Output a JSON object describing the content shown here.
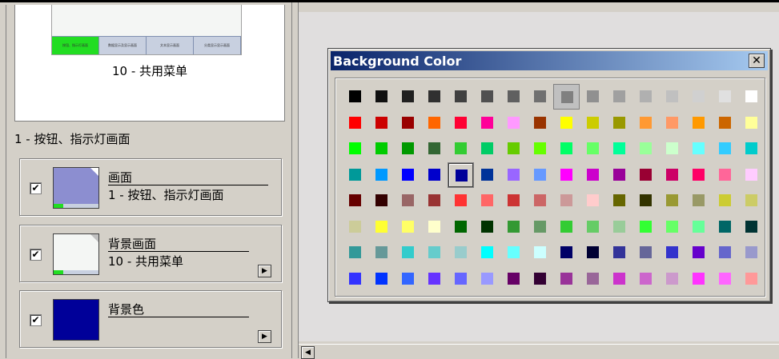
{
  "left": {
    "preview": {
      "thumb_tabs": [
        "按钮、指示灯画面",
        "数据显示及显示画面",
        "文本显示画面",
        "分类显示显示画面"
      ],
      "caption": "10 - 共用菜单"
    },
    "screen_title": "1 - 按钮、指示灯画面",
    "layers": [
      {
        "name": "画面",
        "sub": "1 - 按钮、指示灯画面",
        "checked": "✔",
        "arrow": ""
      },
      {
        "name": "背景画面",
        "sub": "10 - 共用菜单",
        "checked": "✔",
        "arrow": "▶"
      },
      {
        "name": "背景色",
        "sub": "",
        "checked": "✔",
        "arrow": "▶",
        "color": "#000099"
      }
    ]
  },
  "dialog": {
    "title": "Background Color",
    "close_icon": "✕",
    "selected_color": "#000099",
    "palette": [
      [
        "#000000",
        "#101010",
        "#202020",
        "#303030",
        "#404040",
        "#505050",
        "#606060",
        "#707070",
        "#808080",
        "#909090",
        "#a0a0a0",
        "#b0b0b0",
        "#c0c0c0",
        "#d0d0d0",
        "#e0e0e0",
        "#ffffff"
      ],
      [
        "#ff0000",
        "#cc0000",
        "#990000",
        "#ff6600",
        "#ff0033",
        "#ff0099",
        "#ff99ff",
        "#993300",
        "#ffff00",
        "#cccc00",
        "#999900",
        "#ff9933",
        "#ff9966",
        "#ff9900",
        "#cc6600",
        "#ffff99"
      ],
      [
        "#00ff00",
        "#00cc00",
        "#009900",
        "#336633",
        "#33cc33",
        "#00cc66",
        "#66cc00",
        "#66ff00",
        "#00ff66",
        "#66ff66",
        "#00ff99",
        "#99ff99",
        "#ccffcc",
        "#66ffff",
        "#33ccff",
        "#00cccc"
      ],
      [
        "#009999",
        "#0099ff",
        "#0000ff",
        "#0000cc",
        "#000099",
        "#003399",
        "#9966ff",
        "#6699ff",
        "#ff00ff",
        "#cc00cc",
        "#990099",
        "#990033",
        "#cc0066",
        "#ff0066",
        "#ff6699",
        "#ffccff"
      ],
      [
        "#660000",
        "#330000",
        "#996666",
        "#993333",
        "#ff3333",
        "#ff6666",
        "#cc3333",
        "#cc6666",
        "#cc9999",
        "#ffcccc",
        "#666600",
        "#333300",
        "#999933",
        "#999966",
        "#cccc33",
        "#cccc66"
      ],
      [
        "#cccc99",
        "#ffff33",
        "#ffff66",
        "#ffffcc",
        "#006600",
        "#003300",
        "#339933",
        "#669966",
        "#33cc33",
        "#66cc66",
        "#99cc99",
        "#33ff33",
        "#66ff66",
        "#66ff99",
        "#006666",
        "#003333"
      ],
      [
        "#339999",
        "#669999",
        "#33cccc",
        "#66cccc",
        "#99cccc",
        "#00ffff",
        "#66ffff",
        "#ccffff",
        "#000066",
        "#000033",
        "#333399",
        "#666699",
        "#3333cc",
        "#6600cc",
        "#6666cc",
        "#9999cc"
      ],
      [
        "#3333ff",
        "#0033ff",
        "#3366ff",
        "#6633ff",
        "#6666ff",
        "#9999ff",
        "#660066",
        "#330033",
        "#993399",
        "#996699",
        "#cc33cc",
        "#cc66cc",
        "#cc99cc",
        "#ff33ff",
        "#ff66ff",
        "#ff9999"
      ]
    ]
  }
}
